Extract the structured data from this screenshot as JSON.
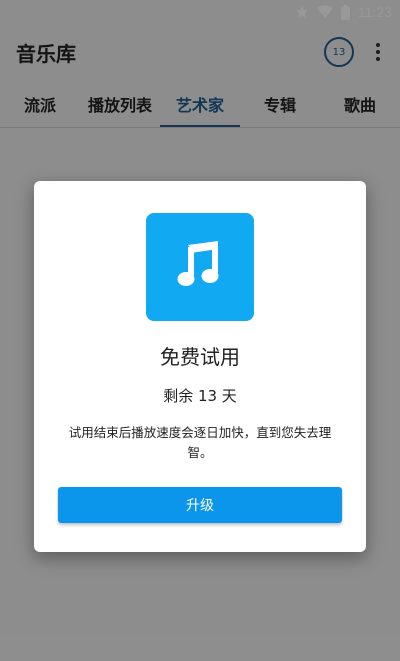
{
  "status_bar": {
    "time": "11:23",
    "icons": [
      "star-icon",
      "wifi-icon",
      "battery-icon"
    ]
  },
  "app_bar": {
    "title": "音乐库",
    "badge_count": "13",
    "more_icon": "more-vert-icon"
  },
  "tabs": [
    {
      "label": "流派",
      "active": false
    },
    {
      "label": "播放列表",
      "active": false
    },
    {
      "label": "艺术家",
      "active": true
    },
    {
      "label": "专辑",
      "active": false
    },
    {
      "label": "歌曲",
      "active": false
    }
  ],
  "dialog": {
    "icon": "music-note-icon",
    "title": "免费试用",
    "days_left": "剩余 13 天",
    "message": "试用结束后播放速度会逐日加快，直到您失去理智。",
    "button_label": "升级"
  },
  "colors": {
    "accent": "#1f5a8c",
    "app_icon_bg": "#11aaf2",
    "button_bg": "#0b96ec",
    "background": "#ececec"
  }
}
